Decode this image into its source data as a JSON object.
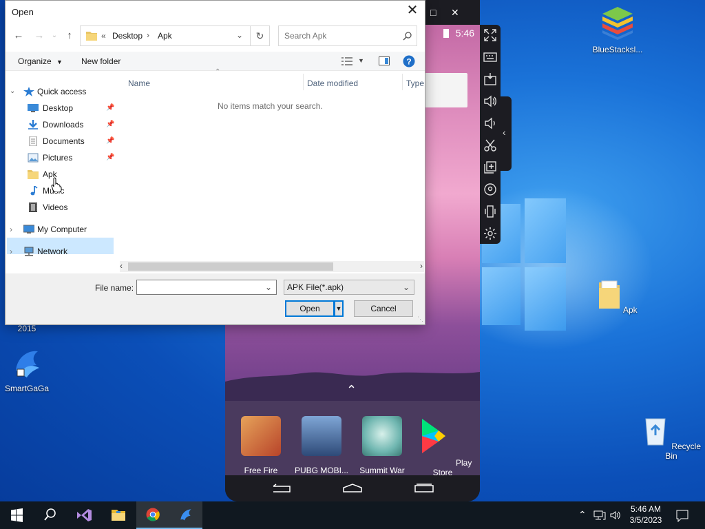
{
  "dialog": {
    "title": "Open",
    "breadcrumb": {
      "prefix": "«",
      "root": "Desktop",
      "separator": "›",
      "current": "Apk"
    },
    "search_placeholder": "Search Apk",
    "toolbar": {
      "organize": "Organize",
      "new_folder": "New folder"
    },
    "nav": {
      "quick_access": "Quick access",
      "items": [
        {
          "label": "Desktop",
          "icon": "desktop-icon",
          "pinned": true
        },
        {
          "label": "Downloads",
          "icon": "download-icon",
          "pinned": true
        },
        {
          "label": "Documents",
          "icon": "document-icon",
          "pinned": true
        },
        {
          "label": "Pictures",
          "icon": "picture-icon",
          "pinned": true
        },
        {
          "label": "Apk",
          "icon": "folder-icon",
          "pinned": false,
          "selected": true
        },
        {
          "label": "Music",
          "icon": "music-icon",
          "pinned": false
        },
        {
          "label": "Videos",
          "icon": "video-icon",
          "pinned": false
        }
      ],
      "my_computer": "My Computer",
      "network": "Network"
    },
    "columns": [
      "Name",
      "Date modified",
      "Type"
    ],
    "empty_message": "No items match your search.",
    "file_name_label": "File name:",
    "file_name_value": "",
    "file_type": "APK File(*.apk)",
    "open_label": "Open",
    "cancel_label": "Cancel"
  },
  "bluestacks": {
    "time": "5:46",
    "apps": [
      {
        "label": "Free Fire",
        "color": "#c9532a"
      },
      {
        "label": "PUBG MOBI...",
        "color": "#5b7aa8"
      },
      {
        "label": "Summit War",
        "color": "#6fb6b0"
      },
      {
        "label": "Play Store",
        "color": "#ffffff"
      }
    ]
  },
  "desktop": {
    "icons": [
      {
        "label": "BlueStacksl..."
      },
      {
        "label": "Apk"
      },
      {
        "label": "Recycle Bin"
      },
      {
        "label": "SmartGaGa"
      },
      {
        "label": "2015"
      }
    ]
  },
  "taskbar": {
    "time": "5:46 AM",
    "date": "3/5/2023"
  },
  "colors": {
    "selection": "#cce8ff",
    "accent": "#0078d7",
    "taskbar": "#101820"
  }
}
